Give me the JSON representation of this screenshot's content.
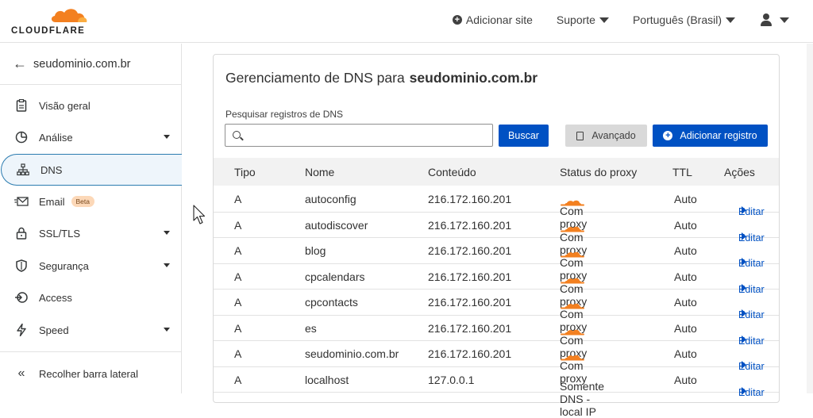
{
  "brand": {
    "logo_text": "CLOUDFLARE",
    "accent": "#f38020",
    "primary_blue": "#0051c3"
  },
  "topnav": {
    "add_site": "Adicionar site",
    "support": "Suporte",
    "language": "Português (Brasil)"
  },
  "sidebar": {
    "domain": "seudominio.com.br",
    "items": [
      {
        "label": "Visão geral",
        "icon": "clipboard-icon"
      },
      {
        "label": "Análise",
        "icon": "chart-pie-icon",
        "expandable": true
      },
      {
        "label": "DNS",
        "icon": "network-icon",
        "active": true
      },
      {
        "label": "Email",
        "icon": "mail-icon",
        "badge": "Beta"
      },
      {
        "label": "SSL/TLS",
        "icon": "lock-icon",
        "expandable": true
      },
      {
        "label": "Segurança",
        "icon": "shield-icon",
        "expandable": true
      },
      {
        "label": "Access",
        "icon": "access-icon"
      },
      {
        "label": "Speed",
        "icon": "lightning-icon",
        "expandable": true
      }
    ],
    "collapse": "Recolher barra lateral"
  },
  "dns": {
    "title_prefix": "Gerenciamento de DNS para",
    "title_domain": "seudominio.com.br",
    "search_label": "Pesquisar registros de DNS",
    "search_value": "",
    "btn_search": "Buscar",
    "btn_advanced": "Avançado",
    "btn_add": "Adicionar registro",
    "columns": [
      "Tipo",
      "Nome",
      "Conteúdo",
      "Status do proxy",
      "TTL",
      "Ações"
    ],
    "rows": [
      {
        "tipo": "A",
        "nome": "autoconfig",
        "conteudo": "216.172.160.201",
        "proxy": "Com proxy",
        "proxied": true,
        "ttl": "Auto",
        "acao": "Editar"
      },
      {
        "tipo": "A",
        "nome": "autodiscover",
        "conteudo": "216.172.160.201",
        "proxy": "Com proxy",
        "proxied": true,
        "ttl": "Auto",
        "acao": "Editar"
      },
      {
        "tipo": "A",
        "nome": "blog",
        "conteudo": "216.172.160.201",
        "proxy": "Com proxy",
        "proxied": true,
        "ttl": "Auto",
        "acao": "Editar"
      },
      {
        "tipo": "A",
        "nome": "cpcalendars",
        "conteudo": "216.172.160.201",
        "proxy": "Com proxy",
        "proxied": true,
        "ttl": "Auto",
        "acao": "Editar"
      },
      {
        "tipo": "A",
        "nome": "cpcontacts",
        "conteudo": "216.172.160.201",
        "proxy": "Com proxy",
        "proxied": true,
        "ttl": "Auto",
        "acao": "Editar"
      },
      {
        "tipo": "A",
        "nome": "es",
        "conteudo": "216.172.160.201",
        "proxy": "Com proxy",
        "proxied": true,
        "ttl": "Auto",
        "acao": "Editar"
      },
      {
        "tipo": "A",
        "nome": "seudominio.com.br",
        "conteudo": "216.172.160.201",
        "proxy": "Com proxy",
        "proxied": true,
        "ttl": "Auto",
        "acao": "Editar"
      },
      {
        "tipo": "A",
        "nome": "localhost",
        "conteudo": "127.0.0.1",
        "proxy": "Somente DNS - local IP",
        "proxied": false,
        "ttl": "Auto",
        "acao": "Editar"
      }
    ]
  }
}
